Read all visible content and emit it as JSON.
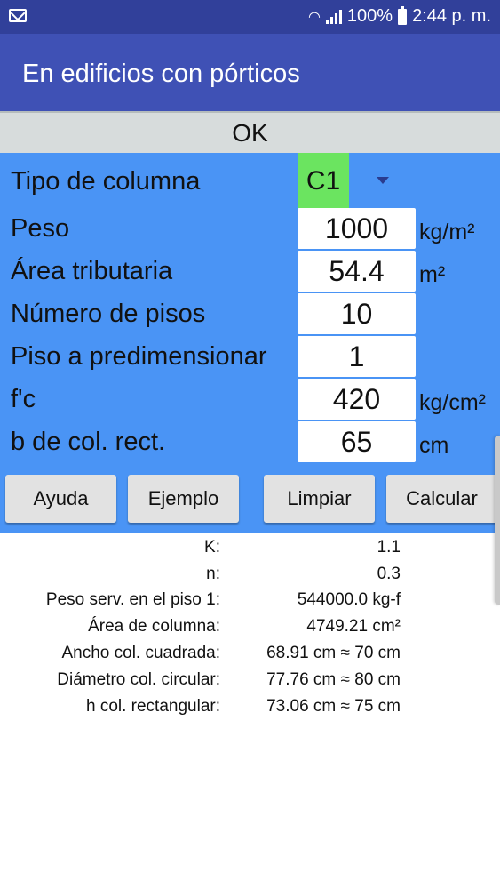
{
  "status": {
    "battery": "100%",
    "time": "2:44 p. m."
  },
  "appbar": {
    "title": "En edificios con pórticos"
  },
  "ok_label": "OK",
  "form": {
    "column_type": {
      "label": "Tipo de columna",
      "value": "C1"
    },
    "rows": [
      {
        "label": "Peso",
        "value": "1000",
        "unit": "kg/m²"
      },
      {
        "label": "Área tributaria",
        "value": "54.4",
        "unit": "m²"
      },
      {
        "label": "Número de pisos",
        "value": "10",
        "unit": ""
      },
      {
        "label": "Piso a predimensionar",
        "value": "1",
        "unit": ""
      },
      {
        "label": "f'c",
        "value": "420",
        "unit": "kg/cm²"
      },
      {
        "label": "b de col. rect.",
        "value": "65",
        "unit": "cm"
      }
    ]
  },
  "buttons": {
    "help": "Ayuda",
    "example": "Ejemplo",
    "clear": "Limpiar",
    "calculate": "Calcular"
  },
  "results": [
    {
      "label": "K:",
      "value": "1.1"
    },
    {
      "label": "n:",
      "value": "0.3"
    },
    {
      "label": "Peso serv. en el piso  1:",
      "value": "544000.0 kg-f"
    },
    {
      "label": "Área de columna:",
      "value": "4749.21 cm²"
    },
    {
      "label": "Ancho col. cuadrada:",
      "value": "68.91 cm  ≈  70 cm"
    },
    {
      "label": "Diámetro col. circular:",
      "value": "77.76 cm  ≈  80 cm"
    },
    {
      "label": "h col. rectangular:",
      "value": "73.06 cm  ≈  75 cm"
    }
  ]
}
